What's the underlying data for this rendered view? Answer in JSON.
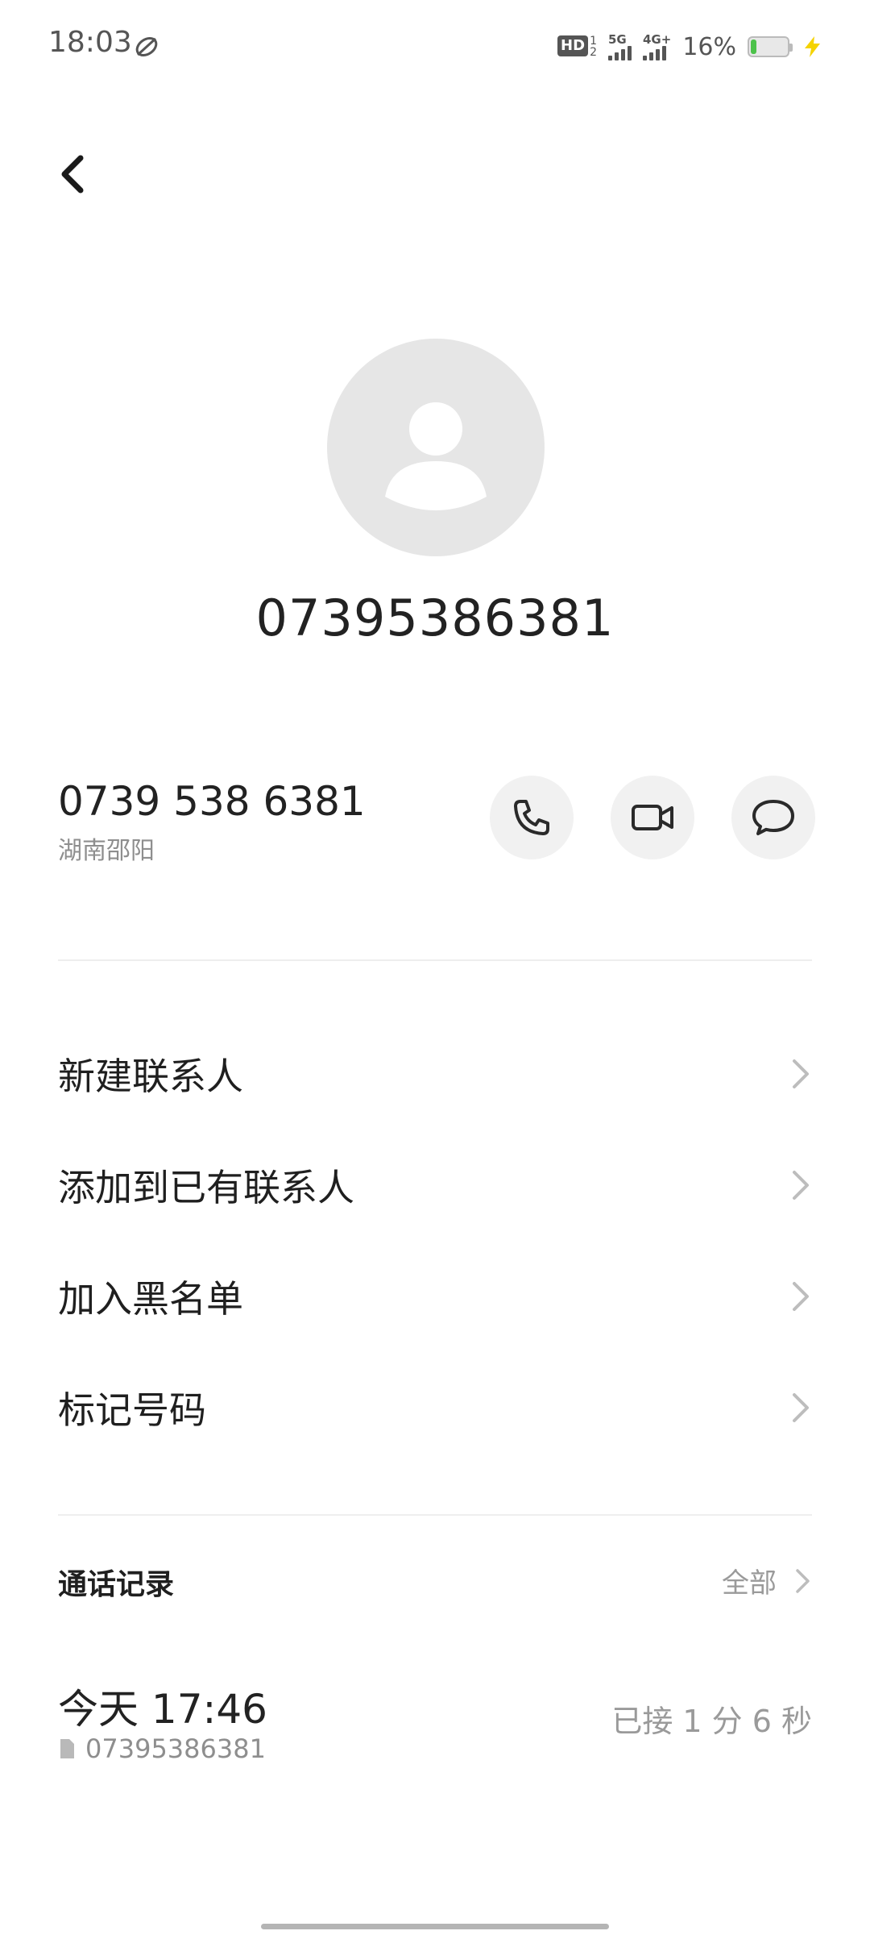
{
  "status_bar": {
    "time": "18:03",
    "hd_label": "HD",
    "hd_sub_top": "1",
    "hd_sub_bottom": "2",
    "network_1": "5G",
    "network_2": "4G+",
    "battery_percent": "16%",
    "battery_level": 0.16,
    "battery_color": "#4cc24a",
    "charging_color": "#f5d300"
  },
  "contact": {
    "title": "07395386381",
    "number_formatted": "0739 538 6381",
    "location": "湖南邵阳"
  },
  "actions": {
    "call_icon": "phone-icon",
    "video_icon": "video-camera-icon",
    "message_icon": "message-bubble-icon"
  },
  "menu": {
    "items": [
      {
        "label": "新建联系人"
      },
      {
        "label": "添加到已有联系人"
      },
      {
        "label": "加入黑名单"
      },
      {
        "label": "标记号码"
      }
    ]
  },
  "call_log": {
    "title": "通话记录",
    "all_label": "全部",
    "entries": [
      {
        "time": "今天 17:46",
        "number": "07395386381",
        "status": "已接 1 分 6 秒"
      }
    ]
  }
}
